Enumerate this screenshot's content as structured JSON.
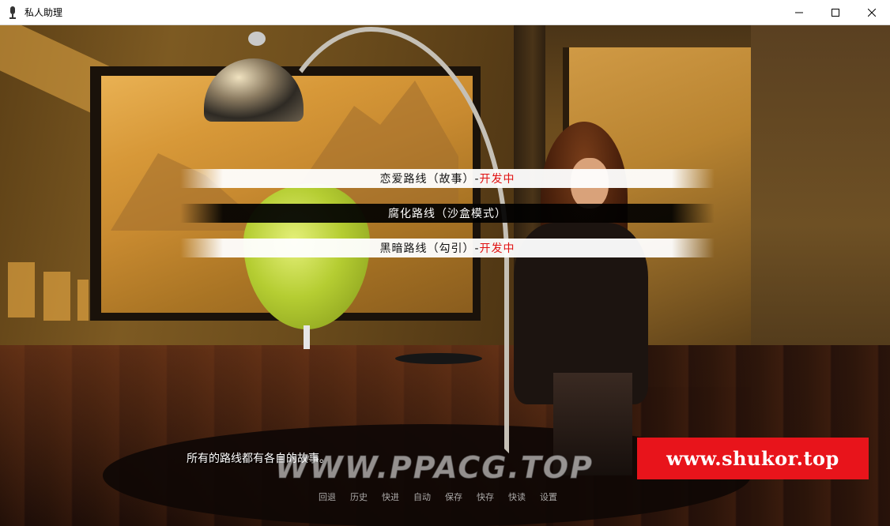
{
  "window": {
    "title": "私人助理",
    "icon": "microphone-icon",
    "controls": [
      "minimize-icon",
      "maximize-icon",
      "close-icon"
    ]
  },
  "choices": [
    {
      "label": "恋爱路线（故事）- ",
      "tag": "开发中",
      "style": "light"
    },
    {
      "label": "腐化路线（沙盒模式）",
      "tag": "",
      "style": "dark"
    },
    {
      "label": "黑暗路线（勾引）- ",
      "tag": "开发中",
      "style": "light"
    }
  ],
  "dialogue": "所有的路线都有各自的故事。",
  "watermarks": {
    "ppacg": "WWW.PPACG.TOP",
    "shukor": "www.shukor.top"
  },
  "quick_menu": [
    "回退",
    "历史",
    "快进",
    "自动",
    "保存",
    "快存",
    "快读",
    "设置"
  ],
  "colors": {
    "tag_red": "#e01010",
    "watermark_red": "#e8141b"
  }
}
